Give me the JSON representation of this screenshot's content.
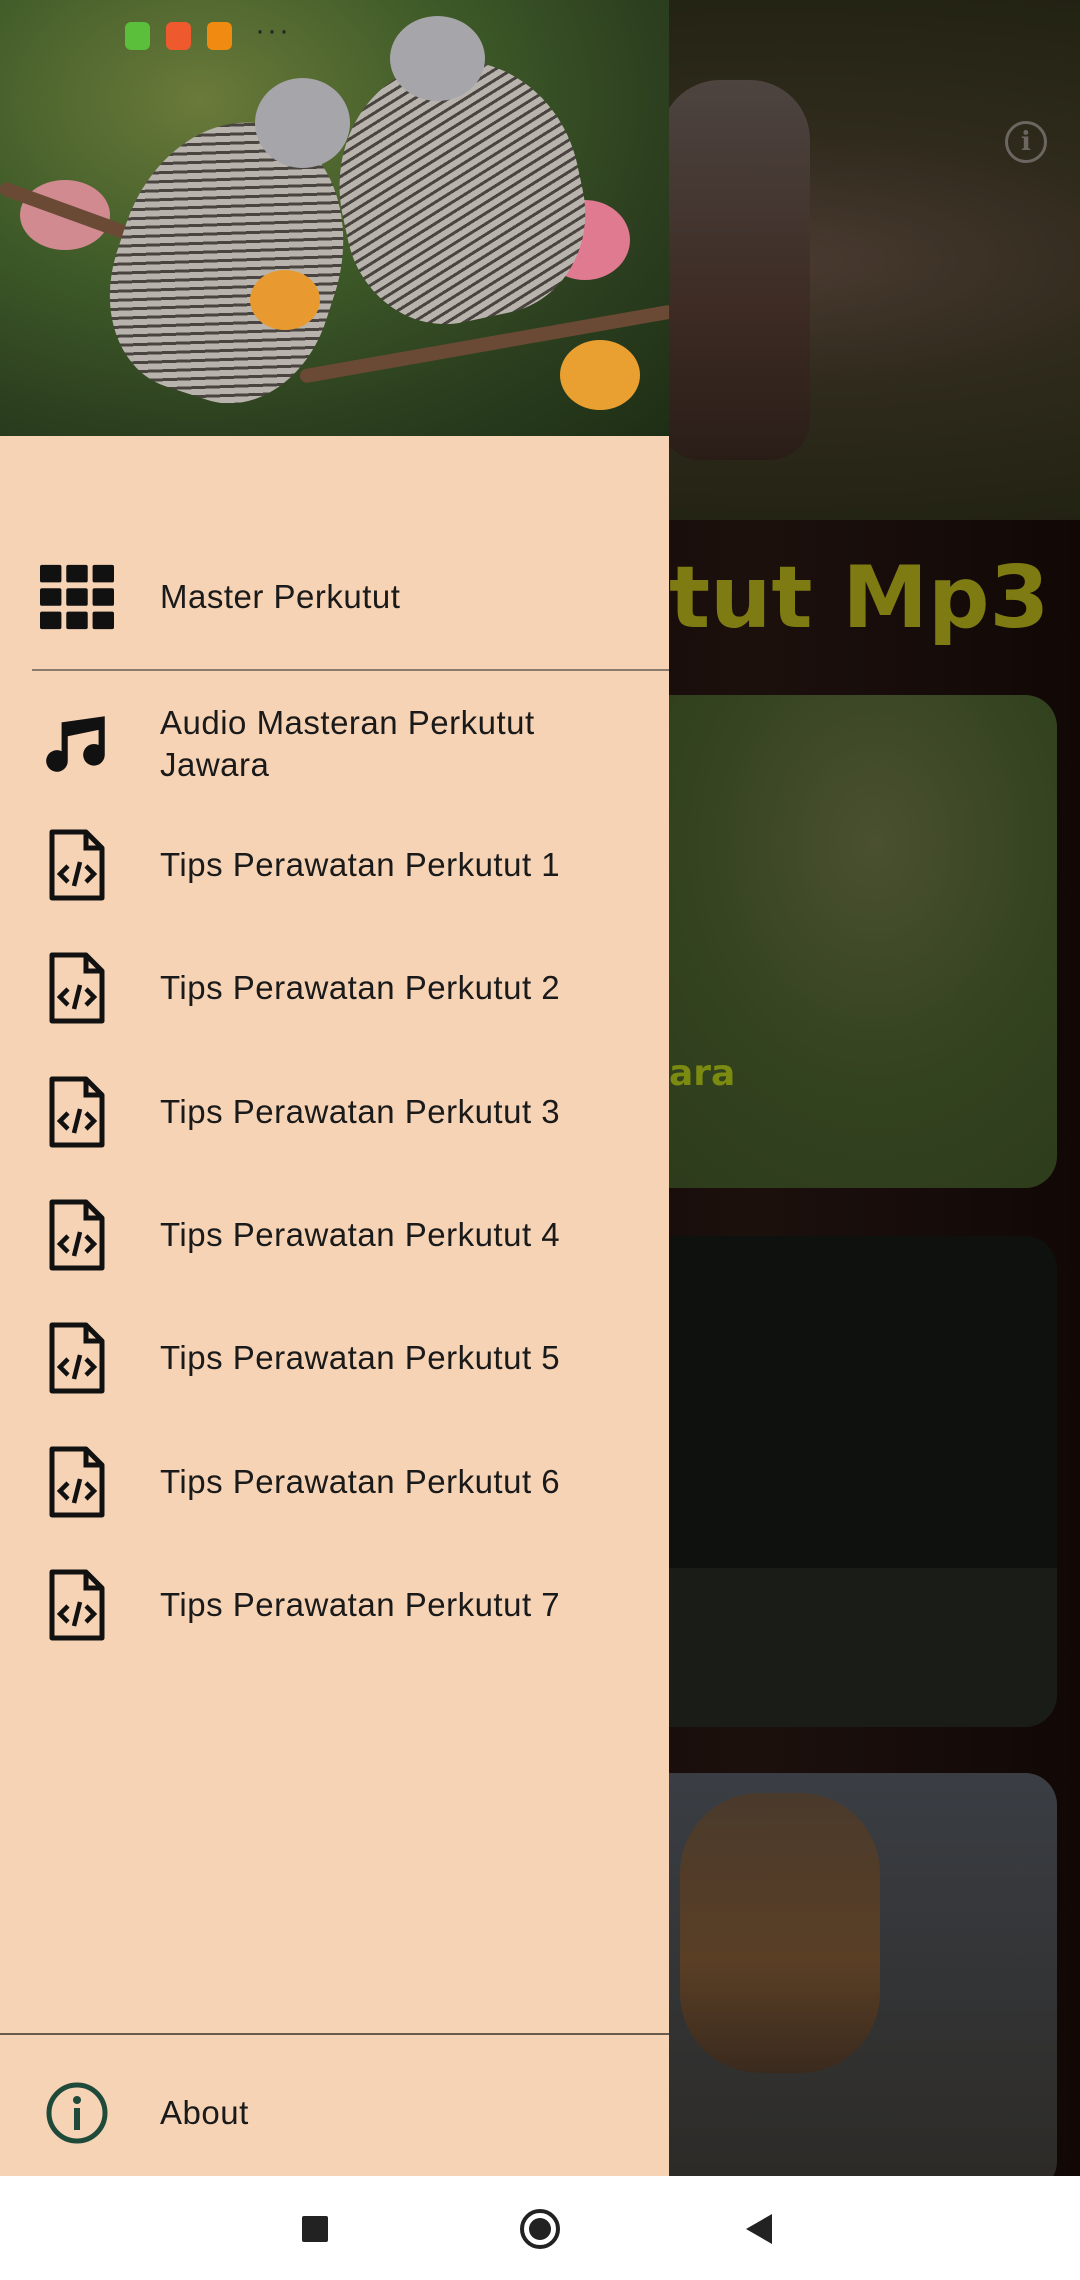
{
  "status_bar": {
    "app_icons": [
      "android-icon",
      "shopee-icon",
      "shield-icon"
    ],
    "more": "···"
  },
  "background": {
    "title_visible": "tut Mp3",
    "card1_label_visible": "ara",
    "info_icon": "info-icon"
  },
  "drawer": {
    "header_image": "perkutut-doves-photo",
    "items": [
      {
        "label": "Master Perkutut",
        "icon": "grid-icon"
      },
      {
        "label": "Audio Masteran Perkutut Jawara",
        "icon": "music-note-icon"
      },
      {
        "label": "Tips Perawatan Perkutut 1",
        "icon": "code-file-icon"
      },
      {
        "label": "Tips Perawatan Perkutut 2",
        "icon": "code-file-icon"
      },
      {
        "label": "Tips Perawatan Perkutut 3",
        "icon": "code-file-icon"
      },
      {
        "label": "Tips Perawatan Perkutut 4",
        "icon": "code-file-icon"
      },
      {
        "label": "Tips Perawatan Perkutut 5",
        "icon": "code-file-icon"
      },
      {
        "label": "Tips Perawatan Perkutut 6",
        "icon": "code-file-icon"
      },
      {
        "label": "Tips Perawatan Perkutut 7",
        "icon": "code-file-icon"
      }
    ],
    "footer": {
      "label": "About",
      "icon": "info-icon"
    }
  },
  "colors": {
    "drawer_bg": "#f6d3b5",
    "title_accent": "#7e7b12",
    "about_icon": "#1f4a3a"
  },
  "nav_bar": {
    "buttons": [
      "recents",
      "home",
      "back"
    ]
  }
}
